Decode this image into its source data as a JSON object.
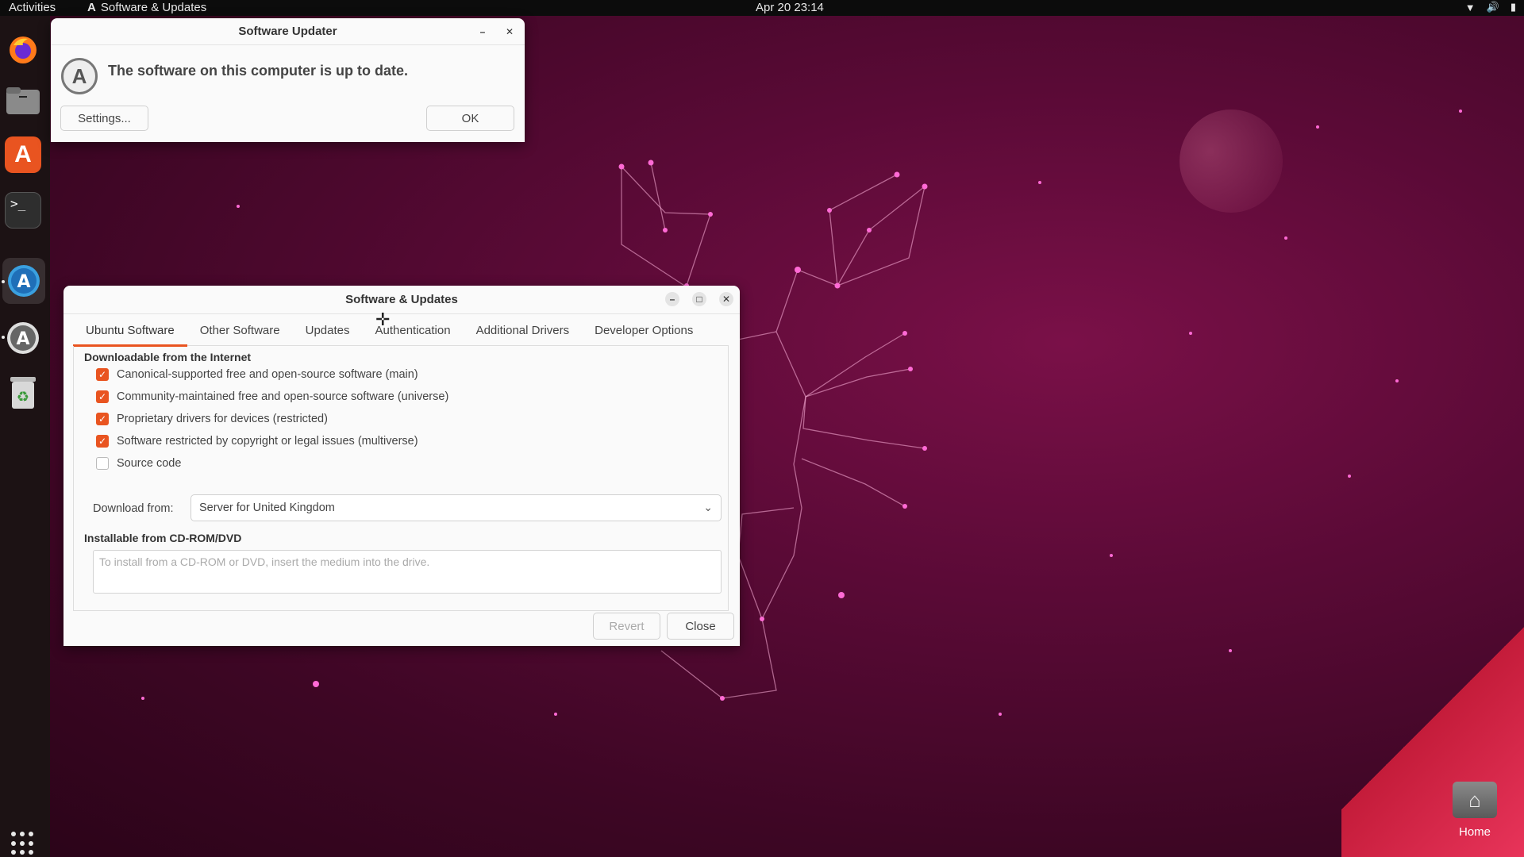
{
  "topbar": {
    "activities": "Activities",
    "app_name": "Software & Updates",
    "clock": "Apr 20  23:14"
  },
  "dock": {
    "items": [
      {
        "name": "firefox-icon"
      },
      {
        "name": "files-icon"
      },
      {
        "name": "app-center-icon"
      },
      {
        "name": "terminal-icon"
      },
      {
        "name": "software-updates-icon"
      },
      {
        "name": "software-updater-icon"
      },
      {
        "name": "trash-icon"
      }
    ]
  },
  "desktop": {
    "home_label": "Home"
  },
  "updater": {
    "title": "Software Updater",
    "message": "The software on this computer is up to date.",
    "settings_button": "Settings...",
    "ok_button": "OK"
  },
  "swu": {
    "title": "Software & Updates",
    "tabs": [
      {
        "label": "Ubuntu Software",
        "active": true
      },
      {
        "label": "Other Software",
        "active": false
      },
      {
        "label": "Updates",
        "active": false
      },
      {
        "label": "Authentication",
        "active": false
      },
      {
        "label": "Additional Drivers",
        "active": false
      },
      {
        "label": "Developer Options",
        "active": false
      }
    ],
    "section_internet": "Downloadable from the Internet",
    "options": [
      {
        "label": "Canonical-supported free and open-source software (main)",
        "checked": true
      },
      {
        "label": "Community-maintained free and open-source software (universe)",
        "checked": true
      },
      {
        "label": "Proprietary drivers for devices (restricted)",
        "checked": true
      },
      {
        "label": "Software restricted by copyright or legal issues (multiverse)",
        "checked": true
      },
      {
        "label": "Source code",
        "checked": false
      }
    ],
    "download_from_label": "Download from:",
    "download_from_value": "Server for United Kingdom",
    "section_cdrom": "Installable from CD-ROM/DVD",
    "cdrom_placeholder": "To install from a CD-ROM or DVD, insert the medium into the drive.",
    "revert_button": "Revert",
    "close_button": "Close"
  },
  "colors": {
    "accent": "#e95420",
    "topbar": "#0c0c0c",
    "dock": "#1c1214",
    "wallpaper": "#5a0a36"
  }
}
